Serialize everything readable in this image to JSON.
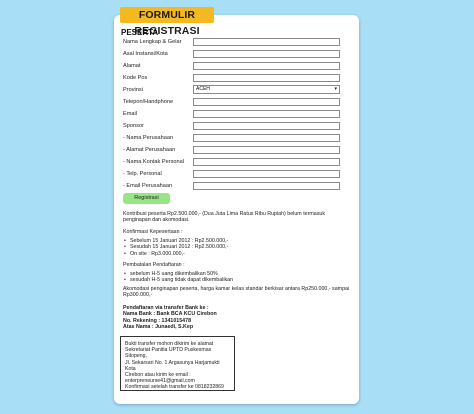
{
  "form": {
    "title": "FORMULIR REGISTRASI",
    "section": "PESERTA",
    "fields": [
      {
        "label": "Nama Lengkap & Gelar"
      },
      {
        "label": "Asal Instansi/Kota"
      },
      {
        "label": "Alamat"
      },
      {
        "label": "Kode Pos"
      },
      {
        "label": "Provinsi",
        "value": "ACEH"
      },
      {
        "label": "Telepon/Handphone"
      },
      {
        "label": "Email"
      },
      {
        "label": "Sponsor"
      },
      {
        "label": "- Nama Perusahaan"
      },
      {
        "label": "- Alamat Perusahaan"
      },
      {
        "label": "- Nama Kontak Personal"
      },
      {
        "label": "- Telp. Personal"
      },
      {
        "label": "- Email Perusahaan"
      }
    ],
    "register_label": "Registrasi"
  },
  "info": {
    "contribution": "Kontribusi peserta Rp2.500.000,- (Dua Juta Lima Ratus Ribu Rupiah) belum termasuk penginapan dan akomodasi.",
    "confirm_title": "Konfirmasi Kepesertaan :",
    "confirm_items": [
      "Sebelum 15 Januari 2012 : Rp2.500.000,-",
      "Sesudah 15 Januari 2012 : Rp2.500.000,-",
      "On site : Rp3.000.000,-"
    ],
    "cancel_title": "Pembatalan Pendaftaran :",
    "cancel_items": [
      "sebelum H-5 uang dikembalikan 50%",
      "sesudah H-5 uang tidak dapat dikembalikan"
    ],
    "accommodation": "Akomodasi penginapan peserta, harga kamar kelas standar berkisar antara Rp250.000,- sampai Rp300.000,-",
    "bank": [
      "Pendaftaran via transfer Bank ke :",
      "Nama Bank : Bank BCA KCU Cirebon",
      "No. Rekening : 1341015478",
      "Atas Nama : Junaedi, S.Kep"
    ],
    "note": [
      "Bukti transfer mohon dikirim ke alamat",
      "Sekretariat Panitia UPTD Puskesmas",
      "Sitopeng,",
      "Jl. Sekarsari No. 1 Argasunya Harjamukti Kota",
      "Cirebon atau kirim ke email :",
      "enterpreneurse41@gmail.com",
      "Konfirmasi setelah transfer ke 0818232869"
    ]
  },
  "colors": {
    "background": "#a9def7",
    "title_badge": "#f4b821",
    "button": "#98e585"
  }
}
